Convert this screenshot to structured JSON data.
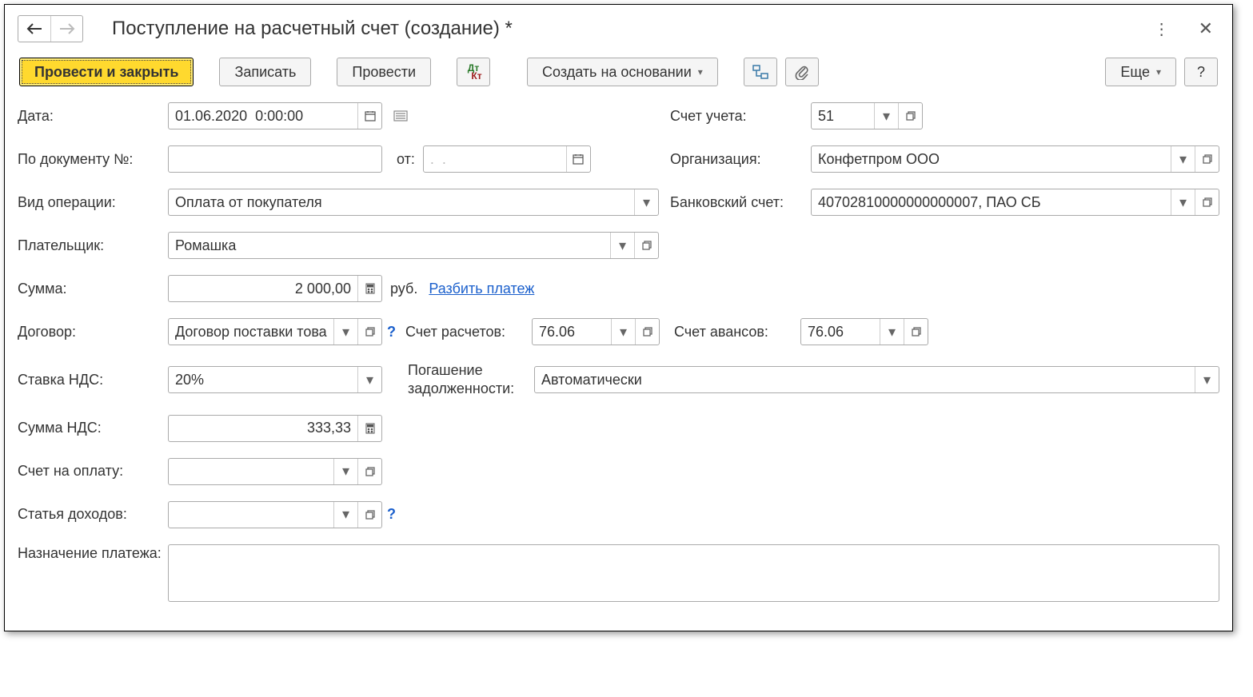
{
  "title": "Поступление на расчетный счет (создание) *",
  "toolbar": {
    "post_close": "Провести и закрыть",
    "save": "Записать",
    "post": "Провести",
    "dt_kt": {
      "dt": "Дт",
      "kt": "Кт"
    },
    "create_based": "Создать на основании",
    "more": "Еще",
    "help": "?"
  },
  "labels": {
    "date": "Дата:",
    "by_doc_no": "По документу №:",
    "by_doc_from": "от:",
    "op_type": "Вид операции:",
    "payer": "Плательщик:",
    "amount": "Сумма:",
    "currency": "руб.",
    "split_payment": "Разбить платеж",
    "contract": "Договор:",
    "vat_rate": "Ставка НДС:",
    "vat_amount": "Сумма НДС:",
    "invoice": "Счет на оплату:",
    "income_item": "Статья доходов:",
    "purpose": "Назначение платежа:",
    "account": "Счет учета:",
    "org": "Организация:",
    "bank_account": "Банковский счет:",
    "settle_account": "Счет расчетов:",
    "advance_account": "Счет авансов:",
    "debt_repayment": "Погашение задолженности:"
  },
  "values": {
    "date": "01.06.2020  0:00:00",
    "by_doc_no": "",
    "by_doc_date": ".  .",
    "op_type": "Оплата от покупателя",
    "payer": "Ромашка",
    "amount": "2 000,00",
    "contract": "Договор поставки товара",
    "vat_rate": "20%",
    "vat_amount": "333,33",
    "invoice": "",
    "income_item": "",
    "purpose": "",
    "account": "51",
    "org": "Конфетпром ООО",
    "bank_account": "40702810000000000007, ПАО СБ",
    "settle_account": "76.06",
    "advance_account": "76.06",
    "debt_repayment": "Автоматически"
  }
}
